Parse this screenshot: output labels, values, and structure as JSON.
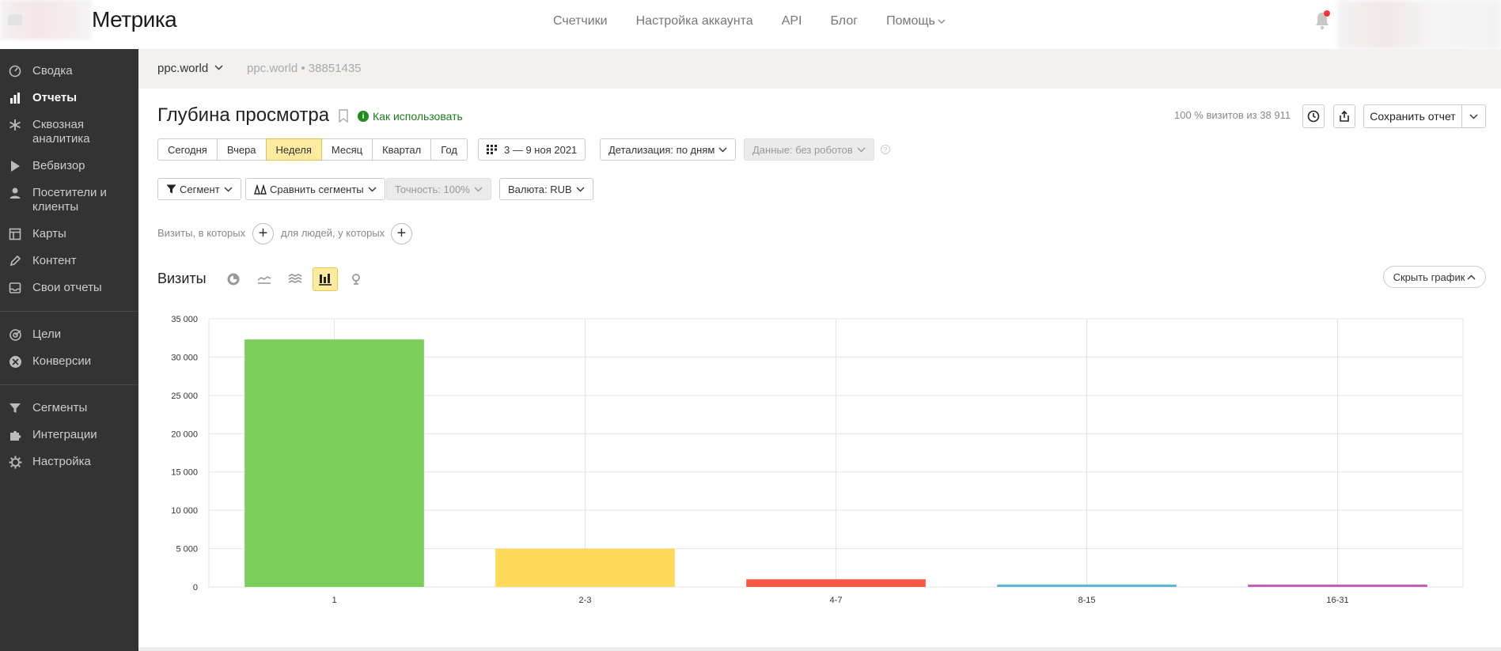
{
  "app": {
    "logo_text": "Метрика"
  },
  "topnav": {
    "items": [
      "Счетчики",
      "Настройка аккаунта",
      "API",
      "Блог",
      "Помощь"
    ]
  },
  "sidebar": {
    "items": [
      {
        "label": "Сводка",
        "icon": "dashboard-icon"
      },
      {
        "label": "Отчеты",
        "icon": "bar-chart-icon",
        "active": true
      },
      {
        "label": "Сквозная аналитика",
        "icon": "snowflake-icon"
      },
      {
        "label": "Вебвизор",
        "icon": "play-icon"
      },
      {
        "label": "Посетители и клиенты",
        "icon": "person-icon"
      },
      {
        "label": "Карты",
        "icon": "map-icon"
      },
      {
        "label": "Контент",
        "icon": "pencil-icon"
      },
      {
        "label": "Свои отчеты",
        "icon": "inbox-icon"
      },
      {
        "label": "Цели",
        "icon": "target-icon"
      },
      {
        "label": "Конверсии",
        "icon": "conversions-icon"
      },
      {
        "label": "Сегменты",
        "icon": "filter-icon"
      },
      {
        "label": "Интеграции",
        "icon": "puzzle-icon"
      },
      {
        "label": "Настройка",
        "icon": "gear-icon"
      }
    ]
  },
  "counter": {
    "name": "ppc.world",
    "id_text": "ppc.world • 38851435"
  },
  "report": {
    "title": "Глубина просмотра",
    "how_to_use": "Как использовать",
    "visits_share": "100 % визитов из 38 911",
    "save_label": "Сохранить отчет"
  },
  "periods": {
    "items": [
      "Сегодня",
      "Вчера",
      "Неделя",
      "Месяц",
      "Квартал",
      "Год"
    ],
    "active": "Неделя",
    "date_range": "3 — 9 ноя 2021"
  },
  "controls": {
    "detail": "Детализация: по дням",
    "data": "Данные: без роботов",
    "segment": "Сегмент",
    "compare": "Сравнить сегменты",
    "accuracy": "Точность: 100%",
    "currency": "Валюта: RUB"
  },
  "conditions": {
    "visits_label": "Визиты, в которых",
    "people_label": "для людей, у которых"
  },
  "chart_section": {
    "title": "Визиты",
    "hide_label": "Скрыть график",
    "types": [
      "pie-chart-icon",
      "line-chart-icon",
      "stacked-area-icon",
      "bar-chart-icon",
      "map-pin-icon"
    ],
    "active_type": "bar-chart-icon"
  },
  "chart_data": {
    "type": "bar",
    "categories": [
      "1",
      "2-3",
      "4-7",
      "8-15",
      "16-31"
    ],
    "values": [
      32300,
      5000,
      1000,
      300,
      300
    ],
    "colors": [
      "#7ccf5a",
      "#ffd959",
      "#f55a42",
      "#5ab5d9",
      "#c45ab5"
    ],
    "ylim": [
      0,
      35000
    ],
    "yticks": [
      0,
      5000,
      10000,
      15000,
      20000,
      25000,
      30000,
      35000
    ],
    "ytick_labels": [
      "0",
      "5 000",
      "10 000",
      "15 000",
      "20 000",
      "25 000",
      "30 000",
      "35 000"
    ],
    "grid": true
  }
}
